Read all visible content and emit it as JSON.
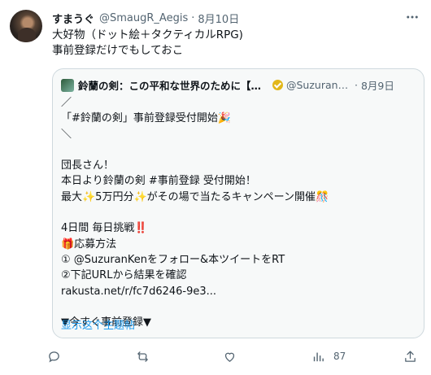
{
  "tweet": {
    "author_name": "すまうぐ",
    "author_handle": "@SmaugR_Aegis",
    "separator": "·",
    "date": "8月10日",
    "more_icon": "more-icon",
    "text": "大好物（ドット絵＋タクティカルRPG)\n事前登録だけでもしておこ"
  },
  "quote": {
    "author_name": "鈴蘭の剣：この平和な世界のために【公...",
    "author_handle": "@SuzuranK...",
    "separator": "·",
    "date": "8月9日",
    "verified_color": "#e2b719",
    "text": "／\n「#鈴蘭の剣」事前登録受付開始🎉\n＼\n\n団長さん！\n本日より鈴蘭の剣 #事前登録 受付開始！\n最大✨5万円分✨がその場で当たるキャンペーン開催🎊\n\n4日間 毎日挑戦‼️\n🎁応募方法\n① @SuzuranKenをフォロー&本ツイートをRT\n②下記URLから結果を確認\nrakusta.net/r/fc7d6246-9e3...\n\n▼今すぐ事前登録▼",
    "show_thread": "显示这个主题帖"
  },
  "actions": {
    "reply_icon": "reply-icon",
    "retweet_icon": "retweet-icon",
    "like_icon": "like-icon",
    "views_icon": "views-icon",
    "views_count": "87",
    "share_icon": "share-icon"
  },
  "colors": {
    "link": "#1d9bf0",
    "muted": "#536471",
    "border": "#cfd9de"
  }
}
